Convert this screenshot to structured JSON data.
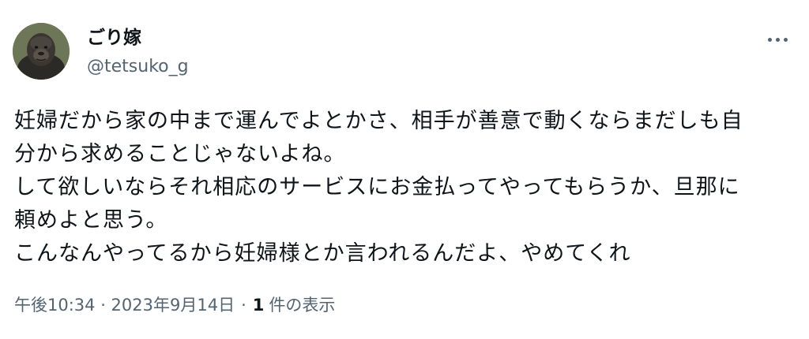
{
  "author": {
    "display_name": "ごり嫁",
    "handle": "@tetsuko_g",
    "avatar_icon": "gorilla-avatar"
  },
  "tweet": {
    "text_lines": [
      "妊婦だから家の中まで運んでよとかさ、相手が善意で動くならまだしも自",
      "分から求めることじゃないよね。",
      "して欲しいならそれ相応のサービスにお金払ってやってもらうか、旦那に",
      "頼めよと思う。",
      "こんなんやってるから妊婦様とか言われるんだよ、やめてくれ"
    ]
  },
  "meta": {
    "timestamp": "午後10:34 · 2023年9月14日",
    "separator": "·",
    "count": "1",
    "count_label": "件の表示"
  },
  "icons": {
    "more": "more-options-icon"
  },
  "colors": {
    "text_primary": "#0f1419",
    "text_secondary": "#536471",
    "background": "#ffffff"
  }
}
